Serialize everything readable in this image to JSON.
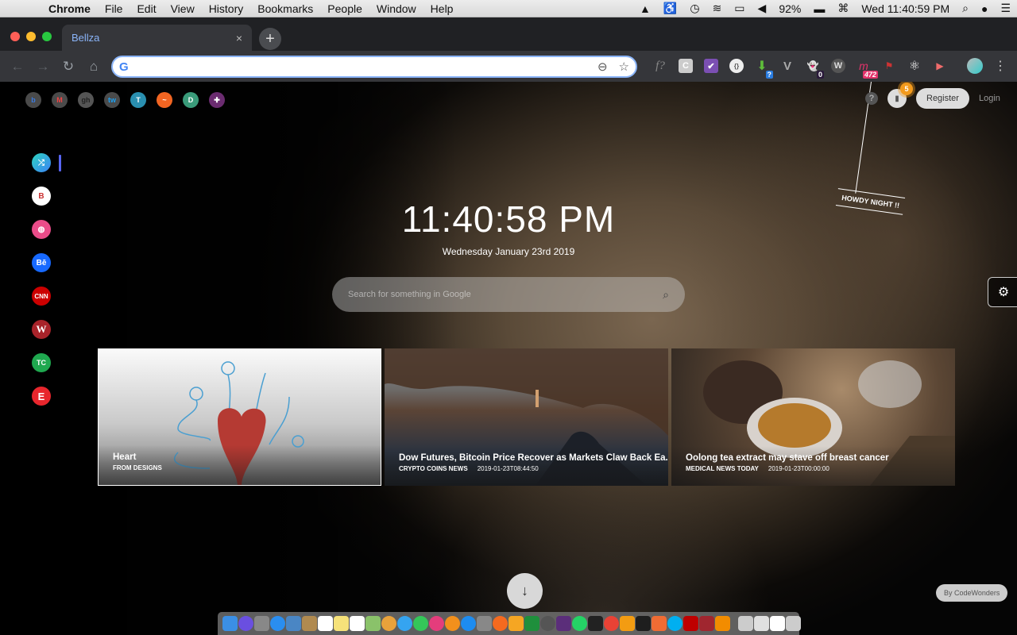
{
  "menubar": {
    "apple_icon": "",
    "app": "Chrome",
    "items": [
      "File",
      "Edit",
      "View",
      "History",
      "Bookmarks",
      "People",
      "Window",
      "Help"
    ],
    "status": {
      "battery": "92%",
      "clock": "Wed 11:40:59 PM"
    }
  },
  "browser": {
    "tab_title": "Bellza",
    "tab_close": "×",
    "new_tab": "+",
    "omnibox": {
      "value": "",
      "placeholder": "",
      "g": "G"
    },
    "extensions": [
      {
        "name": "f?",
        "label": "f?"
      },
      {
        "name": "C",
        "label": "C"
      },
      {
        "name": "todo",
        "label": "✔"
      },
      {
        "name": "json",
        "label": "{}"
      },
      {
        "name": "download",
        "label": "⬇",
        "badge": "?"
      },
      {
        "name": "vue",
        "label": "V"
      },
      {
        "name": "ghostery",
        "label": "👻",
        "badge": "0"
      },
      {
        "name": "w",
        "label": "W"
      },
      {
        "name": "m",
        "label": "m",
        "badge": "472"
      },
      {
        "name": "hashtag",
        "label": "⚑"
      },
      {
        "name": "react",
        "label": "⚛"
      },
      {
        "name": "pinjump",
        "label": "▶"
      }
    ]
  },
  "page": {
    "quick_links": [
      "b",
      "M",
      "gh",
      "tw",
      "T",
      "~",
      "D",
      "✚"
    ],
    "side_links": [
      "shuffle",
      "B",
      "dribbble",
      "Bē",
      "CNN",
      "W",
      "TC",
      "E"
    ],
    "clock": "11:40:58 PM",
    "date": "Wednesday January 23rd 2019",
    "search_placeholder": "Search for something in Google",
    "help": "?",
    "messages_badge": "5",
    "register": "Register",
    "login": "Login",
    "greeting": "HOWDY NIGHT !!",
    "cards": [
      {
        "title": "Heart",
        "source": "FROM DESIGNS",
        "timestamp": ""
      },
      {
        "title": "Dow Futures, Bitcoin Price Recover as Markets Claw Back Ea...",
        "source": "CRYPTO COINS NEWS",
        "timestamp": "2019-01-23T08:44:50"
      },
      {
        "title": "Oolong tea extract may stave off breast cancer",
        "source": "MEDICAL NEWS TODAY",
        "timestamp": "2019-01-23T00:00:00"
      }
    ],
    "scroll_down": "↓",
    "credit": "By CodeWonders",
    "settings": "⚙"
  },
  "dock": {
    "apps": [
      "Finder",
      "Siri",
      "Launchpad",
      "Safari",
      "Preview",
      "Contacts",
      "Calendar",
      "Notes",
      "Reminders",
      "Maps",
      "Photos",
      "Messages",
      "FaceTime",
      "iTunes",
      "Books",
      "App Store",
      "System Preferences",
      "Firefox",
      "Toggl",
      "Excel",
      "Image Capture",
      "Slack",
      "WhatsApp",
      "Terminal",
      "Chrome",
      "Sublime",
      "Figma",
      "Postman",
      "Skype",
      "FileZilla",
      "Dictionary",
      "VLC",
      "Downloads",
      "Documents",
      "Desktop",
      "Trash"
    ],
    "colors": [
      "#3b8fe5",
      "#6a4fe0",
      "#888",
      "#2a8ef0",
      "#4a86c4",
      "#b08a50",
      "#fff",
      "#f6e27a",
      "#fff",
      "#8ac26a",
      "#e9a23b",
      "#35a4f0",
      "#34c759",
      "#e43d7c",
      "#f2901c",
      "#1d8cf0",
      "#888",
      "#f56a1f",
      "#f5a623",
      "#1f8f3c",
      "#555",
      "#5b2e7a",
      "#25d366",
      "#222",
      "#e94235",
      "#f39c12",
      "#1e1e1e",
      "#ef6c34",
      "#00aff0",
      "#bf0000",
      "#a0262f",
      "#f28c00",
      "#ccc",
      "#e0e0e0",
      "#fff",
      "#ccc"
    ]
  }
}
